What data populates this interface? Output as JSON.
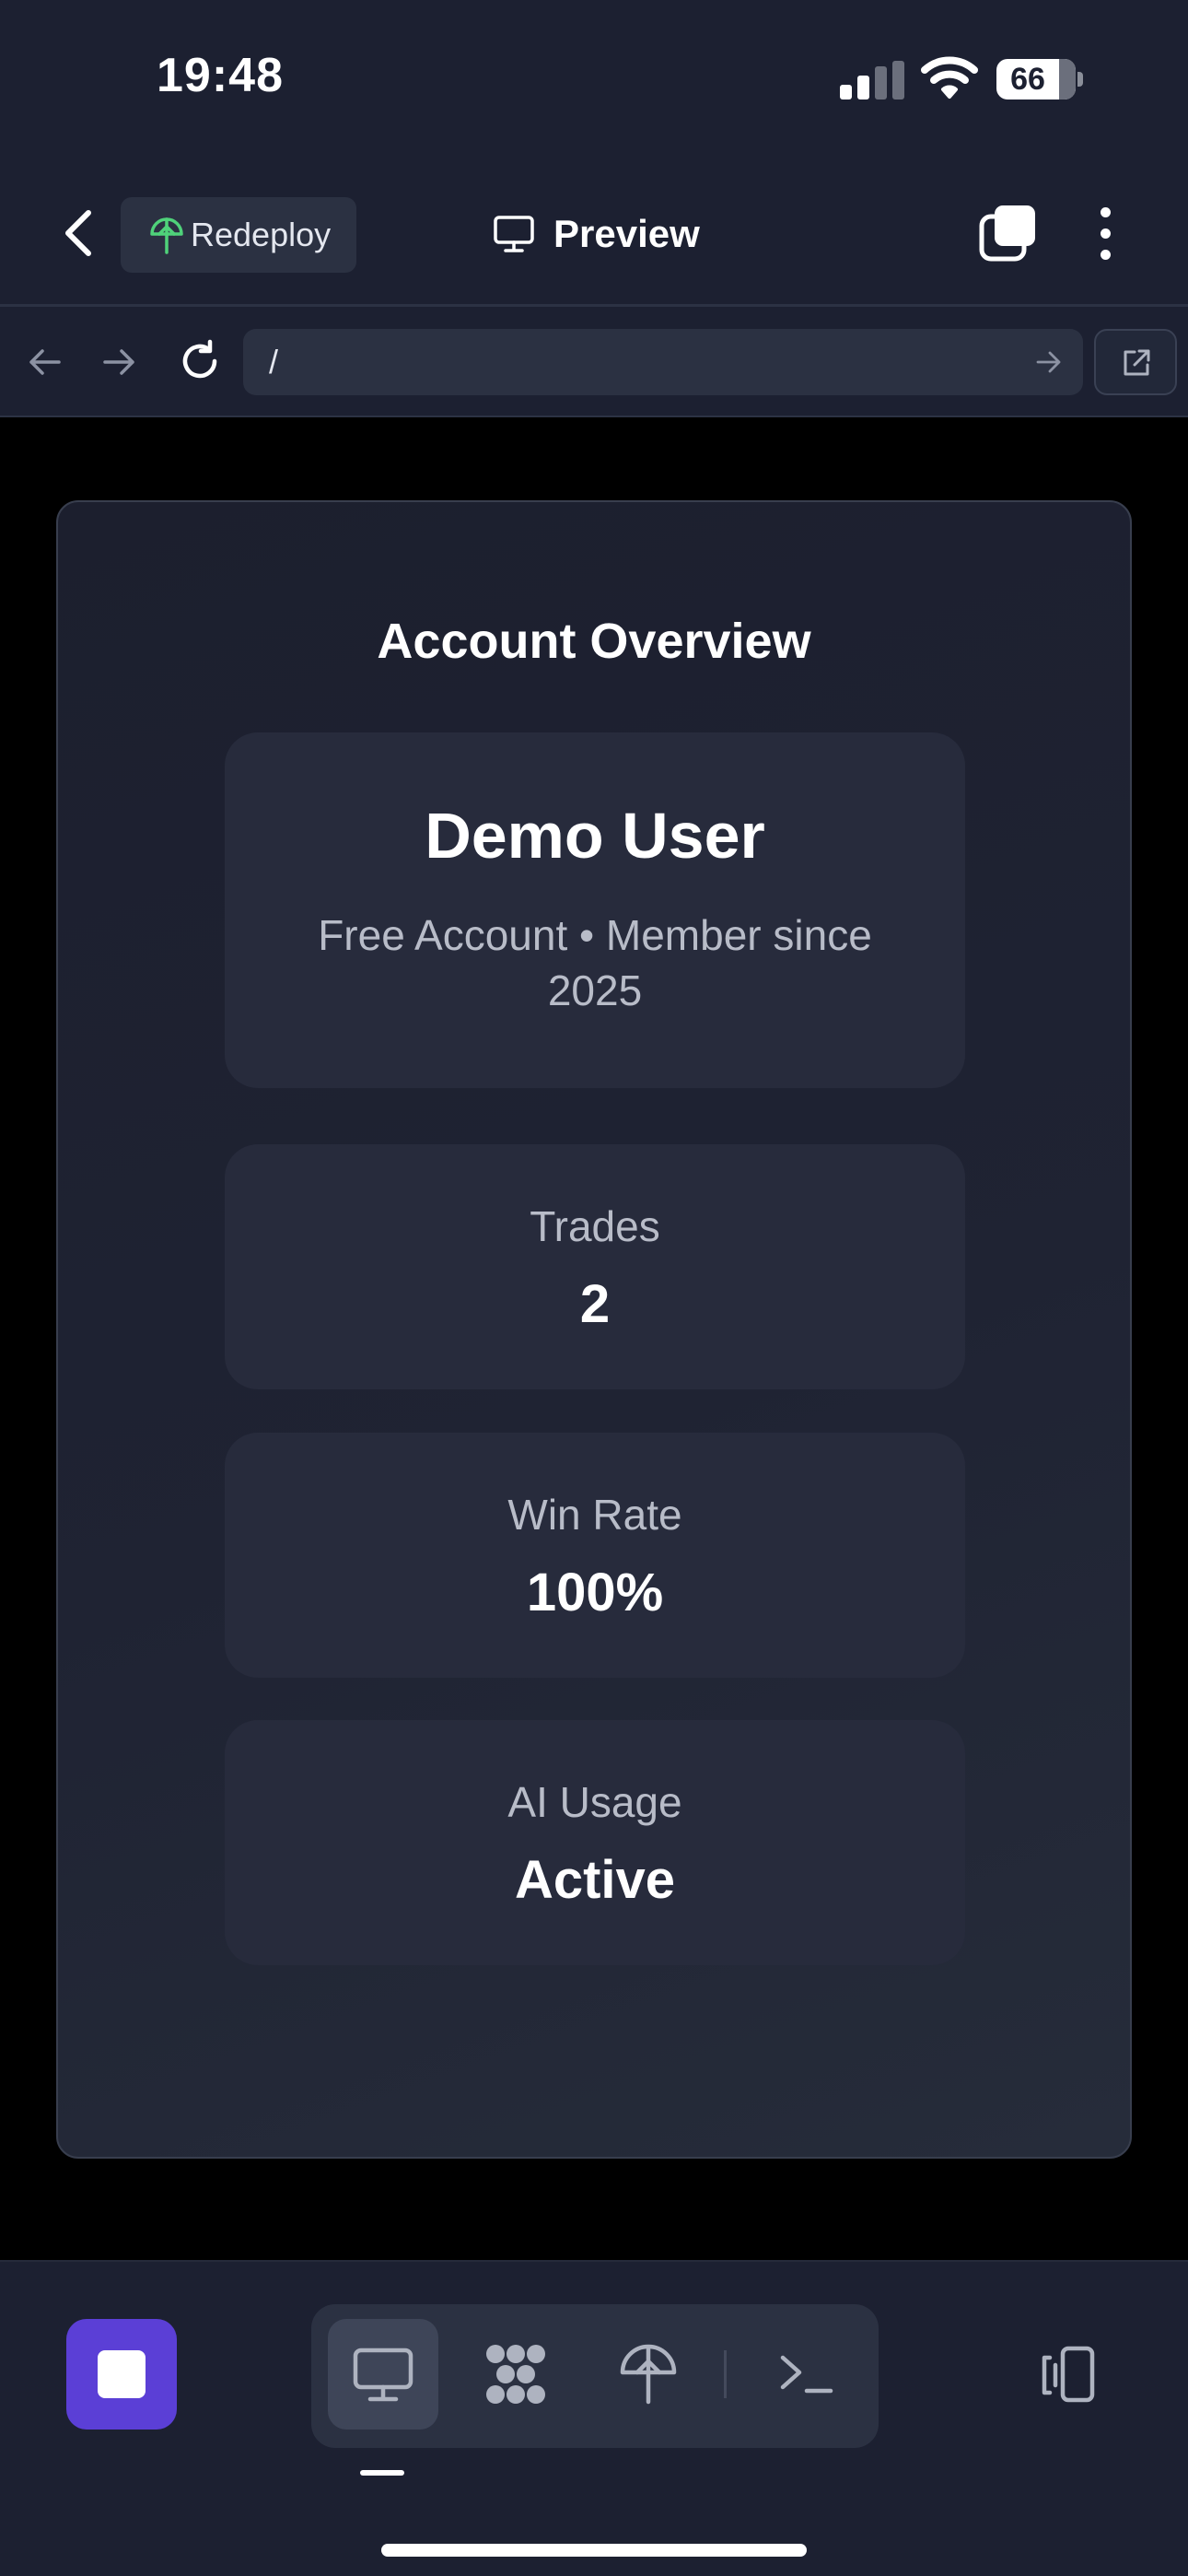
{
  "status_bar": {
    "time": "19:48",
    "battery_level": "66",
    "signal_icon": "cellular-signal-icon",
    "wifi_icon": "wifi-icon"
  },
  "header": {
    "back_icon": "chevron-left-icon",
    "redeploy_label": "Redeploy",
    "redeploy_icon": "deploy-tree-icon",
    "title": "Preview",
    "title_icon": "monitor-icon",
    "windows_icon": "windows-icon",
    "more_icon": "more-vertical-icon"
  },
  "browser": {
    "url": "/",
    "back_icon": "arrow-left-icon",
    "forward_icon": "arrow-right-icon",
    "reload_icon": "reload-icon",
    "go_icon": "arrow-right-icon",
    "external_icon": "open-external-icon"
  },
  "overview": {
    "title": "Account Overview",
    "profile": {
      "name": "Demo User",
      "subtitle": "Free Account • Member since 2025"
    },
    "stats": [
      {
        "label": "Trades",
        "value": "2"
      },
      {
        "label": "Win Rate",
        "value": "100%"
      },
      {
        "label": "AI Usage",
        "value": "Active"
      }
    ]
  },
  "toolbar": {
    "stop_icon": "stop-icon",
    "views": [
      "monitor-icon",
      "ports-icon",
      "deploy-tree-icon",
      "shell-icon"
    ],
    "active_view": "monitor-icon",
    "devices_icon": "devices-icon"
  },
  "colors": {
    "background": "#1c2031",
    "surface": "#2b3142",
    "card": "#272b3c",
    "accent": "#5b3fd6",
    "deploy_green": "#4fd27a",
    "text_muted": "#b8bcc8"
  }
}
